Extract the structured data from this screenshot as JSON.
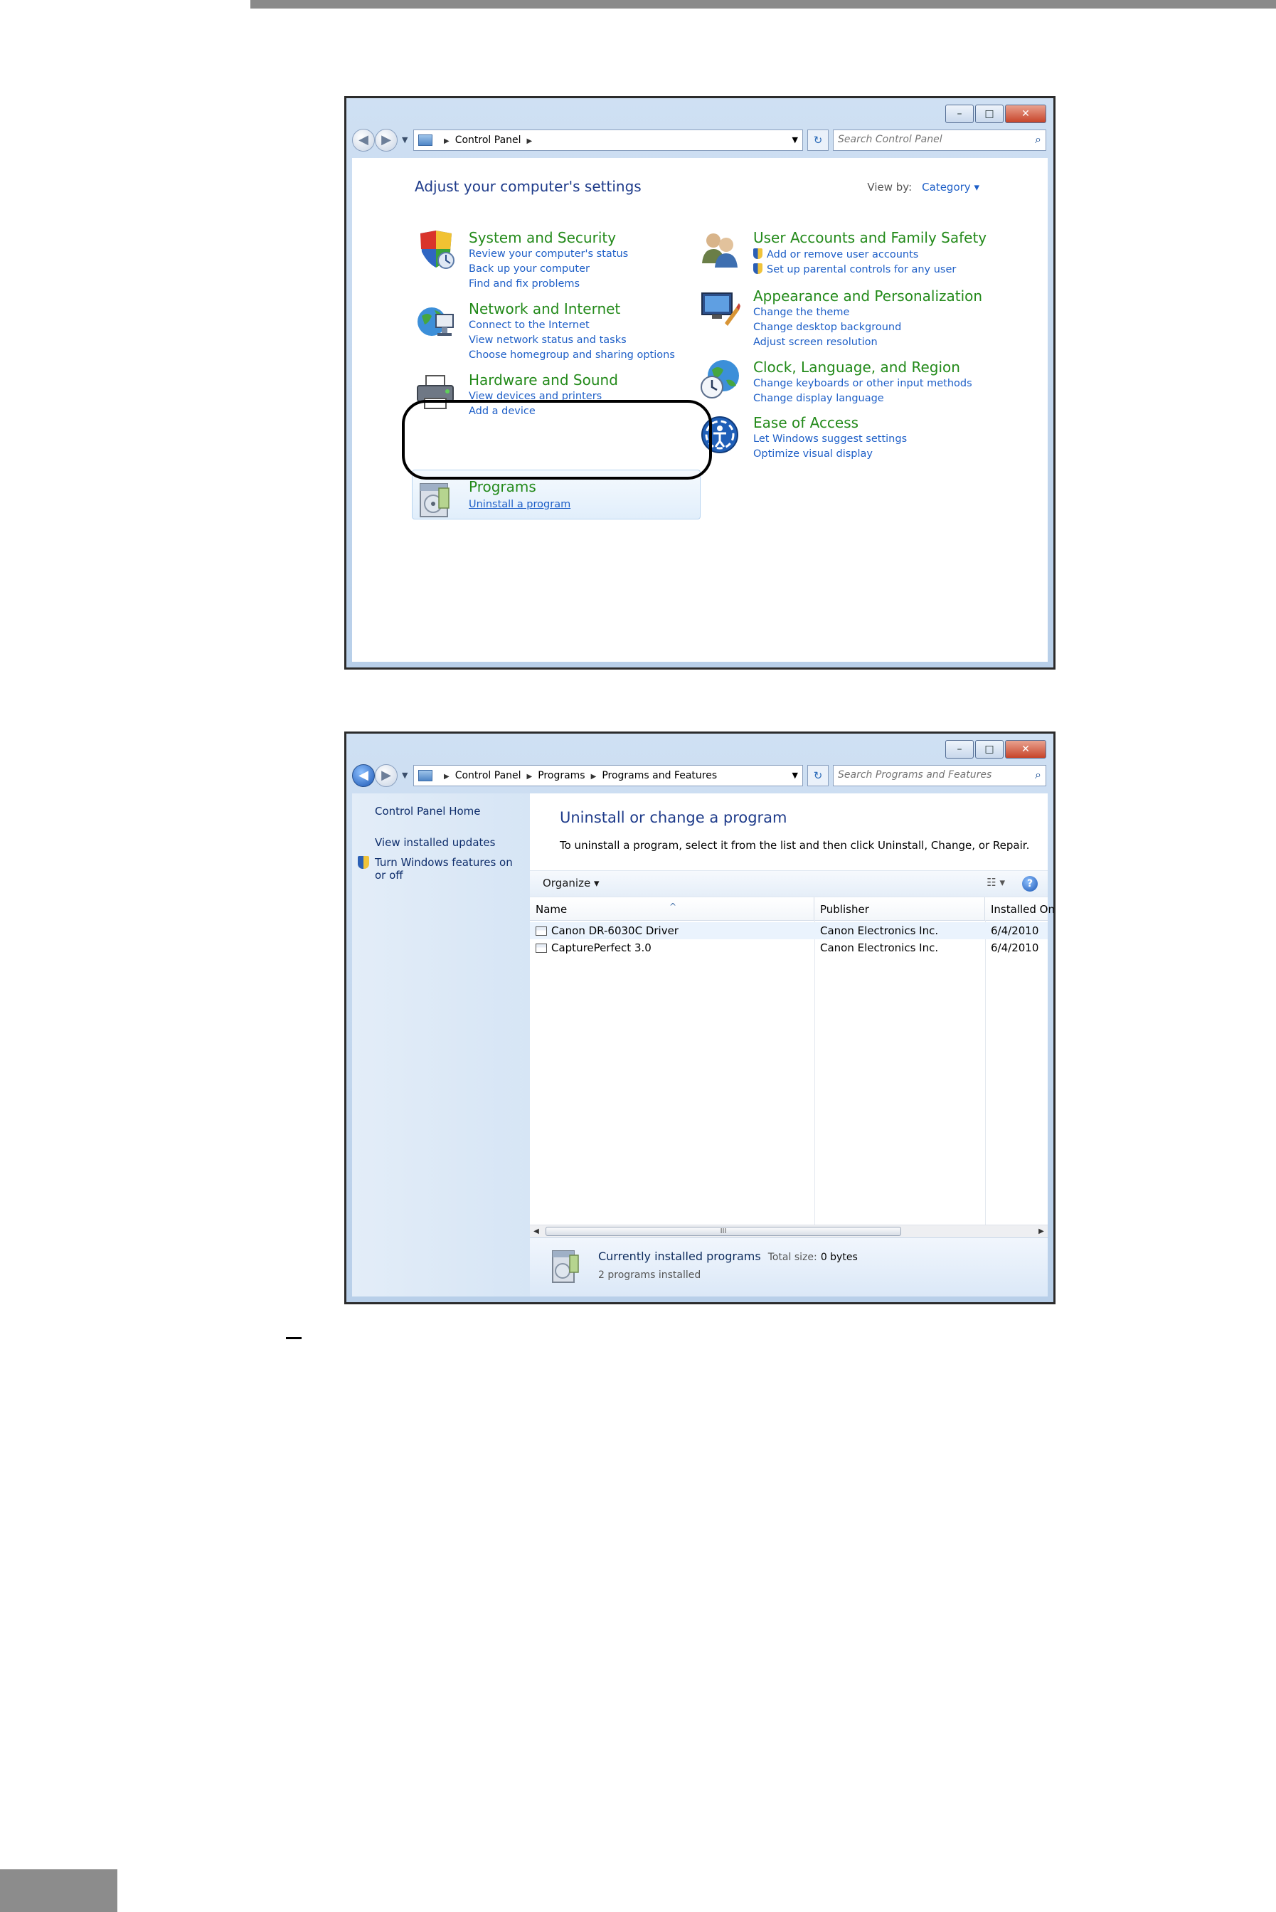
{
  "window1": {
    "controls": {
      "minimize": "–",
      "maximize": "□",
      "close": "✕"
    },
    "breadcrumb": [
      "Control Panel"
    ],
    "search_placeholder": "Search Control Panel",
    "heading": "Adjust your computer's settings",
    "view_by_label": "View by:",
    "view_by_value": "Category",
    "categories": [
      {
        "title": "System and Security",
        "icon": "shield-icon",
        "links": [
          "Review your computer's status",
          "Back up your computer",
          "Find and fix problems"
        ]
      },
      {
        "title": "Network and Internet",
        "icon": "network-globe-icon",
        "links": [
          "Connect to the Internet",
          "View network status and tasks",
          "Choose homegroup and sharing options"
        ]
      },
      {
        "title": "Hardware and Sound",
        "icon": "printer-icon",
        "links": [
          "View devices and printers",
          "Add a device"
        ]
      },
      {
        "title": "Programs",
        "icon": "programs-box-icon",
        "links": [
          "Uninstall a program"
        ]
      },
      {
        "title": "User Accounts and Family Safety",
        "icon": "users-icon",
        "links": [
          "Add or remove user accounts",
          "Set up parental controls for any user"
        ]
      },
      {
        "title": "Appearance and Personalization",
        "icon": "monitor-brush-icon",
        "links": [
          "Change the theme",
          "Change desktop background",
          "Adjust screen resolution"
        ]
      },
      {
        "title": "Clock, Language, and Region",
        "icon": "clock-globe-icon",
        "links": [
          "Change keyboards or other input methods",
          "Change display language"
        ]
      },
      {
        "title": "Ease of Access",
        "icon": "ease-of-access-icon",
        "links": [
          "Let Windows suggest settings",
          "Optimize visual display"
        ]
      }
    ]
  },
  "window2": {
    "controls": {
      "minimize": "–",
      "maximize": "□",
      "close": "✕"
    },
    "breadcrumb": [
      "Control Panel",
      "Programs",
      "Programs and Features"
    ],
    "search_placeholder": "Search Programs and Features",
    "sidebar": {
      "home": "Control Panel Home",
      "updates": "View installed updates",
      "features": "Turn Windows features on or off"
    },
    "title": "Uninstall or change a program",
    "description": "To uninstall a program, select it from the list and then click Uninstall, Change, or Repair.",
    "organize": "Organize",
    "columns": [
      "Name",
      "Publisher",
      "Installed On"
    ],
    "rows": [
      {
        "name": "Canon DR-6030C Driver",
        "publisher": "Canon Electronics Inc.",
        "installed": "6/4/2010"
      },
      {
        "name": "CapturePerfect 3.0",
        "publisher": "Canon Electronics Inc.",
        "installed": "6/4/2010"
      }
    ],
    "scroll_thumb": "III",
    "details": {
      "title": "Currently installed programs",
      "size_label": "Total size:",
      "size_value": "0 bytes",
      "count": "2 programs installed"
    }
  }
}
